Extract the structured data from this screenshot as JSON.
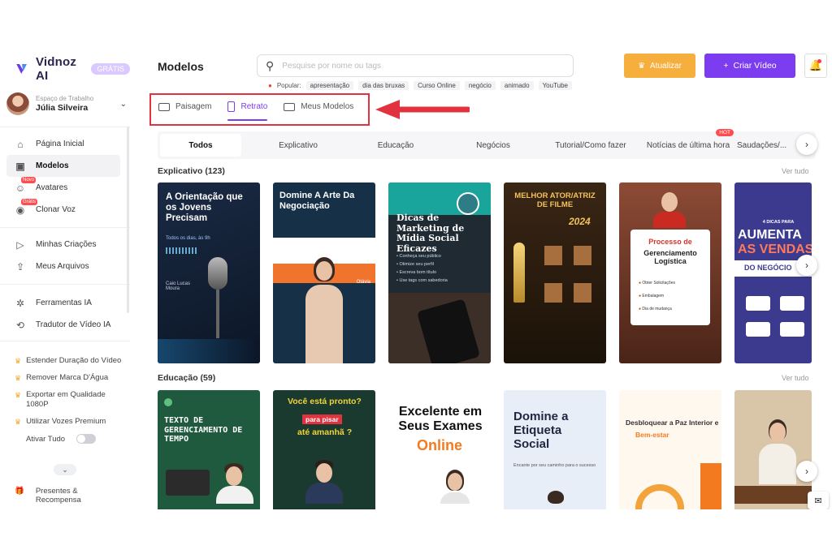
{
  "app": {
    "brand": "Vidnoz AI",
    "badge": "GRÁTIS",
    "workspace_label": "Espaço de Trabalho",
    "workspace_user": "Júlia Silveira"
  },
  "sidebar": {
    "main_items": [
      {
        "label": "Página Inicial",
        "icon": "home-icon"
      },
      {
        "label": "Modelos",
        "icon": "templates-icon",
        "active": true
      },
      {
        "label": "Avatares",
        "icon": "avatar-icon",
        "tag": "Novo"
      },
      {
        "label": "Clonar Voz",
        "icon": "voice-icon",
        "tag": "Grátis"
      }
    ],
    "files_items": [
      {
        "label": "Minhas Criações",
        "icon": "play-icon"
      },
      {
        "label": "Meus Arquivos",
        "icon": "upload-icon"
      }
    ],
    "tools_items": [
      {
        "label": "Ferramentas IA",
        "icon": "tools-icon"
      },
      {
        "label": "Tradutor de Vídeo IA",
        "icon": "translate-icon"
      }
    ],
    "premium_items": [
      "Estender Duração do Vídeo",
      "Remover Marca D'Água",
      "Exportar em Qualidade 1080P",
      "Utilizar Vozes Premium"
    ],
    "toggle_label": "Ativar Tudo",
    "gift_label": "Presentes & Recompensa"
  },
  "header": {
    "title": "Modelos",
    "search_placeholder": "Pesquise por nome ou tags",
    "popular_label": "Popular:",
    "popular_tags": [
      "apresentação",
      "dia das bruxas",
      "Curso Online",
      "negócio",
      "animado",
      "YouTube"
    ],
    "upgrade_label": "Atualizar",
    "create_label": "Criar Vídeo"
  },
  "orientation_tabs": [
    {
      "label": "Paisagem",
      "icon": "landscape-icon"
    },
    {
      "label": "Retrato",
      "icon": "portrait-icon",
      "active": true
    },
    {
      "label": "Meus Modelos",
      "icon": "my-templates-icon"
    }
  ],
  "categories": [
    "Todos",
    "Explicativo",
    "Educação",
    "Negócios",
    "Tutorial/Como fazer",
    "Notícias de última hora",
    "Saudações/..."
  ],
  "hot_badge": "HOT",
  "sections": [
    {
      "title": "Explicativo (123)",
      "see_all": "Ver tudo",
      "cards": [
        {
          "title": "A Orientação que os Jovens Precisam",
          "sub": "Todos os dias, às 9h",
          "foot": "Caio Lucas Moura"
        },
        {
          "title": "Domine A Arte Da Negociação",
          "sub": "Otávia"
        },
        {
          "title": "Dicas de Marketing de Mídia Social Eficazes",
          "bullets": [
            "Conheça seu público",
            "Otimize seu perfil",
            "Escreva bom título",
            "Use tags com sabedoria"
          ]
        },
        {
          "title": "MELHOR ATOR/ATRIZ DE FILME",
          "year": "2024"
        },
        {
          "title": "Processo de Gerenciamento Logística",
          "bullets": [
            "Obter Solicitações",
            "Embalagem",
            "Dia de mudança"
          ]
        },
        {
          "title": "AUMENTA AS VENDAS DO NEGÓCIO",
          "kicker": "4 DICAS PARA"
        }
      ]
    },
    {
      "title": "Educação (59)",
      "see_all": "Ver tudo",
      "cards": [
        {
          "title": "TEXTO DE GERENCIAMENTO DE TEMPO"
        },
        {
          "title": "Você está pronto?",
          "tag": "para pisar",
          "title2": "até amanhã ?"
        },
        {
          "title": "Excelente em Seus Exames",
          "accent": "Online"
        },
        {
          "title": "Domine a Etiqueta Social",
          "sub": "Encante por seu caminho para o sucesso"
        },
        {
          "title": "Desbloquear a Paz Interior e",
          "accent": "Bem-estar"
        },
        {
          "title": ""
        }
      ]
    }
  ],
  "colors": {
    "brand_purple": "#7c3df0",
    "upgrade_orange": "#f6ae3c",
    "highlight_red": "#e0333f"
  }
}
